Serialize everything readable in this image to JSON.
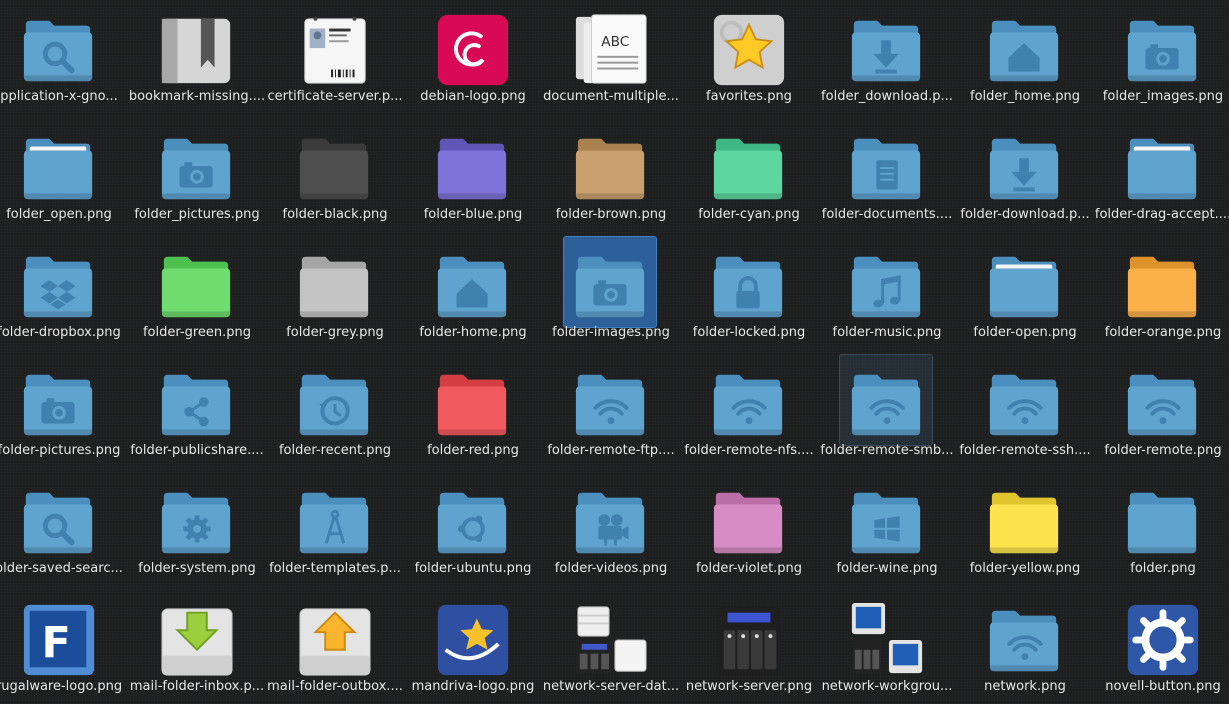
{
  "grid": {
    "columns": 9,
    "selected_index": 22,
    "hover_index": 33,
    "colors": {
      "folder": "#5fa3cf",
      "folder_glyph": "#3f82b0",
      "selection": "#2d5f99",
      "background": "#1e1f20"
    }
  },
  "items": [
    {
      "label": "pplication-x-gno...",
      "icon": "folder-search-icon",
      "kind": "folder",
      "glyph": "search"
    },
    {
      "label": "bookmark-missing....",
      "icon": "bookmark-icon",
      "kind": "bookmark"
    },
    {
      "label": "certificate-server.p...",
      "icon": "id-card-icon",
      "kind": "idcard"
    },
    {
      "label": "debian-logo.png",
      "icon": "debian-swirl-icon",
      "kind": "debian"
    },
    {
      "label": "document-multiple...",
      "icon": "documents-icon",
      "kind": "docs"
    },
    {
      "label": "favorites.png",
      "icon": "star-icon",
      "kind": "favorites"
    },
    {
      "label": "folder_download.p...",
      "icon": "folder-download-icon",
      "kind": "folder",
      "glyph": "download"
    },
    {
      "label": "folder_home.png",
      "icon": "folder-home-icon",
      "kind": "folder",
      "glyph": "home"
    },
    {
      "label": "folder_images.png",
      "icon": "folder-camera-icon",
      "kind": "folder",
      "glyph": "camera"
    },
    {
      "label": "folder_open.png",
      "icon": "folder-open-icon",
      "kind": "folder",
      "glyph": "open"
    },
    {
      "label": "folder_pictures.png",
      "icon": "folder-camera-icon",
      "kind": "folder",
      "glyph": "camera"
    },
    {
      "label": "folder-black.png",
      "icon": "folder-black-icon",
      "kind": "folder",
      "color": "#4e4e4e",
      "dark": "#3b3b3b"
    },
    {
      "label": "folder-blue.png",
      "icon": "folder-blue-icon",
      "kind": "folder",
      "color": "#7d73d9",
      "dark": "#5f56b8"
    },
    {
      "label": "folder-brown.png",
      "icon": "folder-brown-icon",
      "kind": "folder",
      "color": "#c9a06e",
      "dark": "#a9824f"
    },
    {
      "label": "folder-cyan.png",
      "icon": "folder-cyan-icon",
      "kind": "folder",
      "color": "#5ed6a0",
      "dark": "#3fb884"
    },
    {
      "label": "folder-documents....",
      "icon": "folder-document-icon",
      "kind": "folder",
      "glyph": "document"
    },
    {
      "label": "folder-download.p...",
      "icon": "folder-download-icon",
      "kind": "folder",
      "glyph": "download"
    },
    {
      "label": "folder-drag-accept....",
      "icon": "folder-open-icon",
      "kind": "folder",
      "glyph": "open"
    },
    {
      "label": "folder-dropbox.png",
      "icon": "folder-dropbox-icon",
      "kind": "folder",
      "glyph": "dropbox"
    },
    {
      "label": "folder-green.png",
      "icon": "folder-green-icon",
      "kind": "folder",
      "color": "#6fdc6f",
      "dark": "#4fbf4f"
    },
    {
      "label": "folder-grey.png",
      "icon": "folder-grey-icon",
      "kind": "folder",
      "color": "#c4c4c4",
      "dark": "#a5a5a5"
    },
    {
      "label": "folder-home.png",
      "icon": "folder-home-icon",
      "kind": "folder",
      "glyph": "home"
    },
    {
      "label": "folder-images.png",
      "icon": "folder-camera-icon",
      "kind": "folder",
      "glyph": "camera"
    },
    {
      "label": "folder-locked.png",
      "icon": "folder-lock-icon",
      "kind": "folder",
      "glyph": "lock"
    },
    {
      "label": "folder-music.png",
      "icon": "folder-music-icon",
      "kind": "folder",
      "glyph": "music"
    },
    {
      "label": "folder-open.png",
      "icon": "folder-open-icon",
      "kind": "folder",
      "glyph": "open"
    },
    {
      "label": "folder-orange.png",
      "icon": "folder-orange-icon",
      "kind": "folder",
      "color": "#fbb04a",
      "dark": "#dd922c"
    },
    {
      "label": "folder-pictures.png",
      "icon": "folder-camera-icon",
      "kind": "folder",
      "glyph": "camera"
    },
    {
      "label": "folder-publicshare....",
      "icon": "folder-share-icon",
      "kind": "folder",
      "glyph": "share"
    },
    {
      "label": "folder-recent.png",
      "icon": "folder-recent-icon",
      "kind": "folder",
      "glyph": "recent"
    },
    {
      "label": "folder-red.png",
      "icon": "folder-red-icon",
      "kind": "folder",
      "color": "#f25a5f",
      "dark": "#d43d42"
    },
    {
      "label": "folder-remote-ftp....",
      "icon": "folder-remote-icon",
      "kind": "folder",
      "glyph": "wifi"
    },
    {
      "label": "folder-remote-nfs....",
      "icon": "folder-remote-icon",
      "kind": "folder",
      "glyph": "wifi"
    },
    {
      "label": "folder-remote-smb...",
      "icon": "folder-remote-icon",
      "kind": "folder",
      "glyph": "wifi"
    },
    {
      "label": "folder-remote-ssh....",
      "icon": "folder-remote-icon",
      "kind": "folder",
      "glyph": "wifi"
    },
    {
      "label": "folder-remote.png",
      "icon": "folder-remote-icon",
      "kind": "folder",
      "glyph": "wifi"
    },
    {
      "label": "older-saved-searc...",
      "icon": "folder-search-icon",
      "kind": "folder",
      "glyph": "search"
    },
    {
      "label": "folder-system.png",
      "icon": "folder-gear-icon",
      "kind": "folder",
      "glyph": "gear"
    },
    {
      "label": "folder-templates.p...",
      "icon": "folder-compass-icon",
      "kind": "folder",
      "glyph": "compass"
    },
    {
      "label": "folder-ubuntu.png",
      "icon": "folder-ubuntu-icon",
      "kind": "folder",
      "glyph": "ubuntu"
    },
    {
      "label": "folder-videos.png",
      "icon": "folder-video-icon",
      "kind": "folder",
      "glyph": "video"
    },
    {
      "label": "folder-violet.png",
      "icon": "folder-violet-icon",
      "kind": "folder",
      "color": "#d88cc4",
      "dark": "#bb6ea7"
    },
    {
      "label": "folder-wine.png",
      "icon": "folder-windows-icon",
      "kind": "folder",
      "glyph": "windows"
    },
    {
      "label": "folder-yellow.png",
      "icon": "folder-yellow-icon",
      "kind": "folder",
      "color": "#fde44e",
      "dark": "#e0c52f"
    },
    {
      "label": "folder.png",
      "icon": "folder-icon",
      "kind": "folder"
    },
    {
      "label": "rugalware-logo.png",
      "icon": "frugalware-logo-icon",
      "kind": "frugal"
    },
    {
      "label": "mail-folder-inbox.p...",
      "icon": "inbox-icon",
      "kind": "inbox"
    },
    {
      "label": "mail-folder-outbox....",
      "icon": "outbox-icon",
      "kind": "outbox"
    },
    {
      "label": "mandriva-logo.png",
      "icon": "mandriva-star-icon",
      "kind": "mandriva"
    },
    {
      "label": "network-server-dat...",
      "icon": "server-database-icon",
      "kind": "serverdb"
    },
    {
      "label": "network-server.png",
      "icon": "server-icon",
      "kind": "server"
    },
    {
      "label": "network-workgrou...",
      "icon": "workgroup-icon",
      "kind": "workgroup"
    },
    {
      "label": "network.png",
      "icon": "folder-remote-icon",
      "kind": "folder",
      "glyph": "wifi"
    },
    {
      "label": "novell-button.png",
      "icon": "novell-gear-icon",
      "kind": "novell"
    }
  ]
}
